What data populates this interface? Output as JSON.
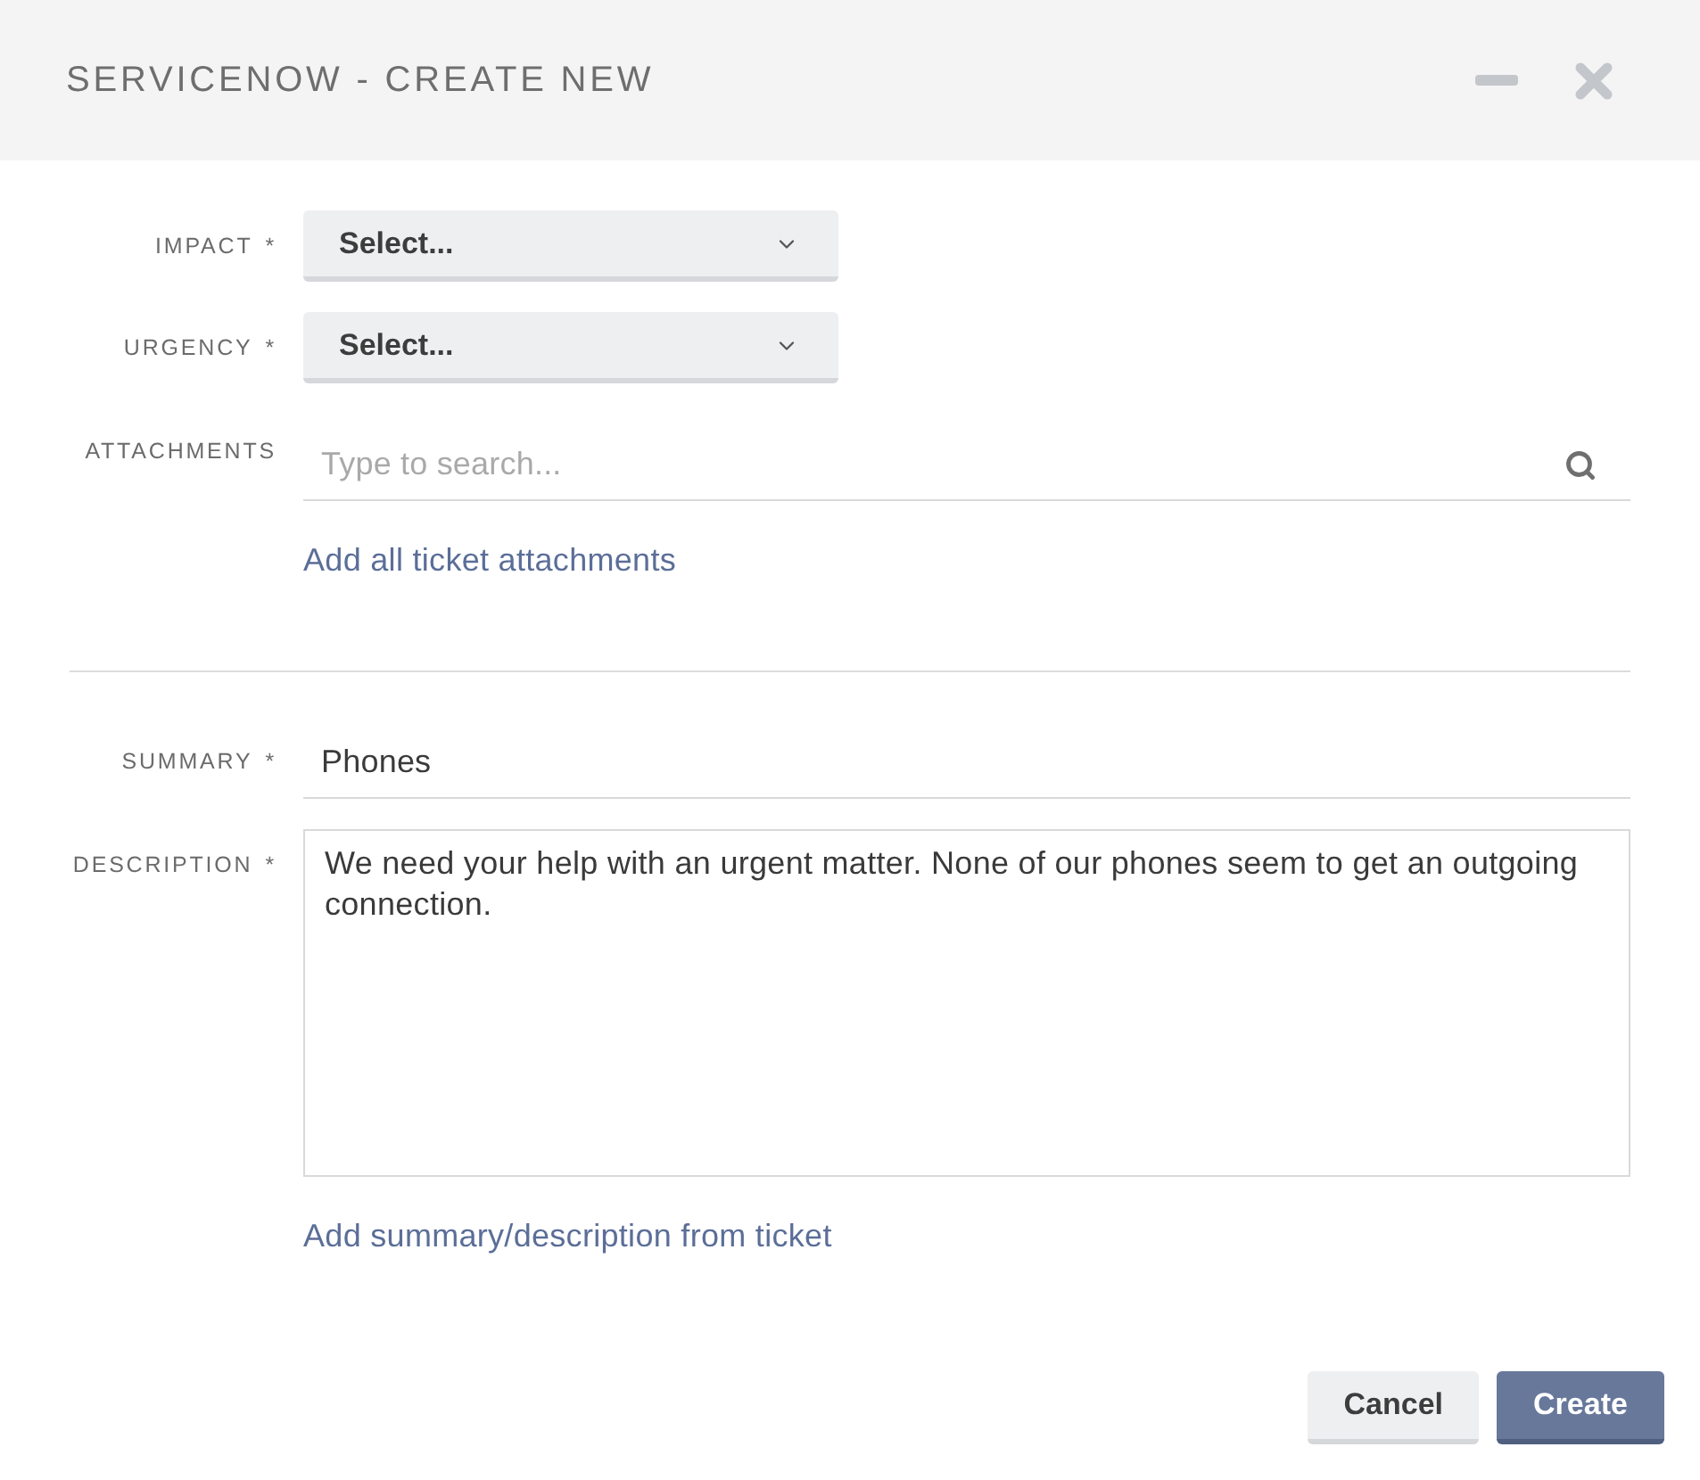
{
  "window": {
    "title": "SERVICENOW - CREATE NEW"
  },
  "sections": [
    {
      "fields": [
        {
          "kind": "select",
          "label": "IMPACT",
          "marker": "*",
          "value": "Select..."
        },
        {
          "kind": "select",
          "label": "URGENCY",
          "marker": "*",
          "value": "Select..."
        },
        {
          "kind": "search",
          "label": "ATTACHMENTS",
          "placeholder": "Type to search...",
          "link": "Add all ticket attachments"
        }
      ]
    },
    {
      "fields": [
        {
          "kind": "text",
          "label": "SUMMARY",
          "marker": "*",
          "value": "Phones"
        },
        {
          "kind": "textarea",
          "label": "DESCRIPTION",
          "marker": "*",
          "value": "We need your help with an urgent matter. None of our phones seem to get an outgoing connection.",
          "link": "Add summary/description from ticket"
        }
      ]
    }
  ],
  "buttons": [
    {
      "kind": "secondary",
      "label": "Cancel"
    },
    {
      "kind": "primary",
      "label": "Create"
    }
  ]
}
